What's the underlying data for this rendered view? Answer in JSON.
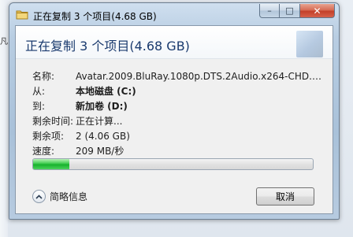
{
  "background": {
    "fragment_text": "凡"
  },
  "dialog": {
    "title": "正在复制 3 个项目(4.68 GB)",
    "header": "正在复制 3 个项目(4.68 GB)",
    "caption_buttons": {
      "minimize": "–",
      "maximize": "□",
      "close": "✕"
    },
    "rows": [
      {
        "label": "名称:",
        "value": "Avatar.2009.BluRay.1080p.DTS.2Audio.x264-CHD.d..."
      },
      {
        "label": "从:",
        "value": "本地磁盘 (C:)"
      },
      {
        "label": "到:",
        "value": "新加卷 (D:)"
      },
      {
        "label": "剩余时间:",
        "value": "正在计算..."
      },
      {
        "label": "剩余项:",
        "value": "2 (4.06 GB)"
      },
      {
        "label": "速度:",
        "value": "209 MB/秒"
      }
    ],
    "progress_percent": 13,
    "details_label": "简略信息",
    "cancel_label": "取消"
  },
  "colors": {
    "progress_green": "#17b22d",
    "header_text": "#1a3a6e",
    "close_button": "#c3402a"
  },
  "icons": {
    "title": "copy-folder-icon",
    "details": "chevron-up-icon"
  }
}
